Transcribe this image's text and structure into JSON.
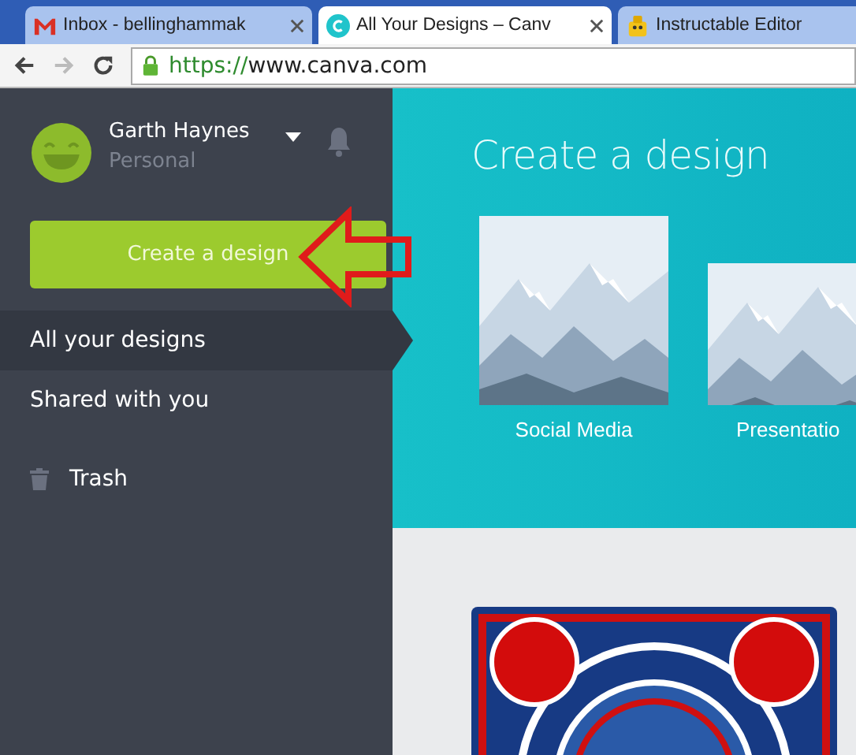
{
  "browser": {
    "tabs": [
      {
        "title": "Inbox - bellinghammak",
        "selected": false
      },
      {
        "title": "All Your Designs – Canv",
        "selected": true
      },
      {
        "title": "Instructable Editor",
        "selected": false
      }
    ],
    "url": {
      "scheme": "https://",
      "rest": "www.canva.com"
    }
  },
  "sidebar": {
    "user": {
      "name": "Garth Haynes",
      "plan": "Personal"
    },
    "create_button": "Create a design",
    "items": [
      {
        "label": "All your designs",
        "selected": true
      },
      {
        "label": "Shared with you",
        "selected": false
      },
      {
        "label": "Trash",
        "selected": false
      }
    ]
  },
  "main": {
    "heading": "Create a design",
    "templates": [
      {
        "label": "Social Media",
        "kind": "picture"
      },
      {
        "label": "Presentatio",
        "kind": "picture"
      }
    ]
  }
}
